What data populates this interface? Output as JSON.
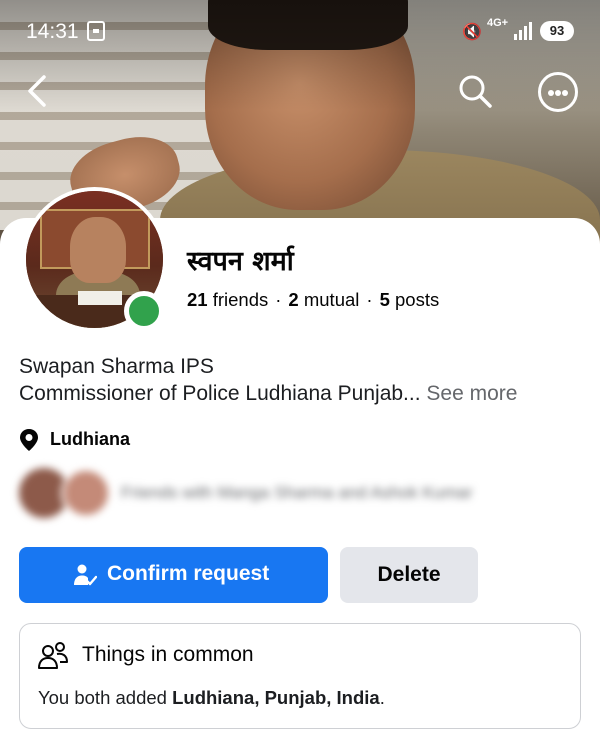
{
  "status_bar": {
    "time": "14:31",
    "network": "4G+",
    "battery": "93"
  },
  "nav": {
    "back_icon": "chevron-left-icon",
    "search_icon": "search-icon",
    "more_icon": "more-options-icon"
  },
  "profile": {
    "name": "स्वपन शर्मा",
    "friends_count": "21",
    "friends_label": "friends",
    "mutual_count": "2",
    "mutual_label": "mutual",
    "posts_count": "5",
    "posts_label": "posts",
    "bio_line1": "Swapan Sharma IPS",
    "bio_line2": "Commissioner of Police Ludhiana Punjab...",
    "see_more": "See more",
    "location": "Ludhiana",
    "mutual_friends_text": "Friends with Manga Sharma and Ashok Kumar"
  },
  "actions": {
    "confirm_label": "Confirm request",
    "delete_label": "Delete"
  },
  "things_in_common": {
    "title": "Things in common",
    "body_prefix": "You both added ",
    "place": "Ludhiana, Punjab, India",
    "body_suffix": "."
  },
  "colors": {
    "accent": "#1877f2",
    "online": "#31a24c",
    "secondary_button": "#e4e6eb",
    "muted_text": "#65676b"
  }
}
